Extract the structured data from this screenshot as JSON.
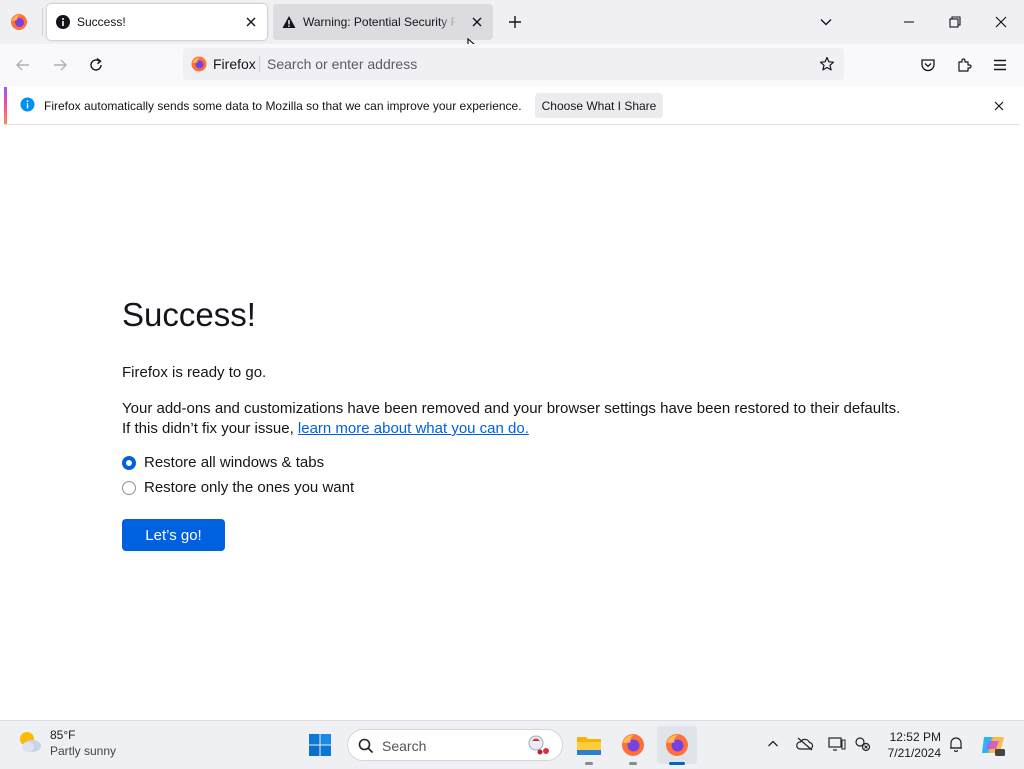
{
  "browser": {
    "tabs": [
      {
        "label": "Success!",
        "icon": "info-icon",
        "active": true
      },
      {
        "label": "Warning: Potential Security Risk Ahead",
        "icon": "warning-icon",
        "active": false
      }
    ],
    "new_tab_icon": "plus-icon",
    "list_all_tabs_icon": "chevron-down-icon",
    "window_controls": [
      "minimize-icon",
      "restore-icon",
      "close-icon"
    ],
    "nav": {
      "identity_label": "Firefox",
      "url_placeholder": "Search or enter address",
      "url_value": ""
    }
  },
  "notification": {
    "message": "Firefox automatically sends some data to Mozilla so that we can improve your experience.",
    "button_label": "Choose What I Share"
  },
  "page": {
    "title": "Success!",
    "ready_text": "Firefox is ready to go.",
    "removed_text": "Your add-ons and customizations have been removed and your browser settings have been restored to their defaults.",
    "fix_text": "If this didn’t fix your issue, ",
    "learn_more_link": "learn more about what you can do.",
    "options": [
      {
        "label": "Restore all windows & tabs",
        "selected": true
      },
      {
        "label": "Restore only the ones you want",
        "selected": false
      }
    ],
    "go_button": "Let’s go!"
  },
  "taskbar": {
    "weather_temp": "85°F",
    "weather_desc": "Partly sunny",
    "search_label": "Search",
    "time": "12:52 PM",
    "date": "7/21/2024"
  },
  "colors": {
    "accent": "#0061e0",
    "tabstrip": "#f0f0f4",
    "taskbar": "#eef0f4"
  }
}
